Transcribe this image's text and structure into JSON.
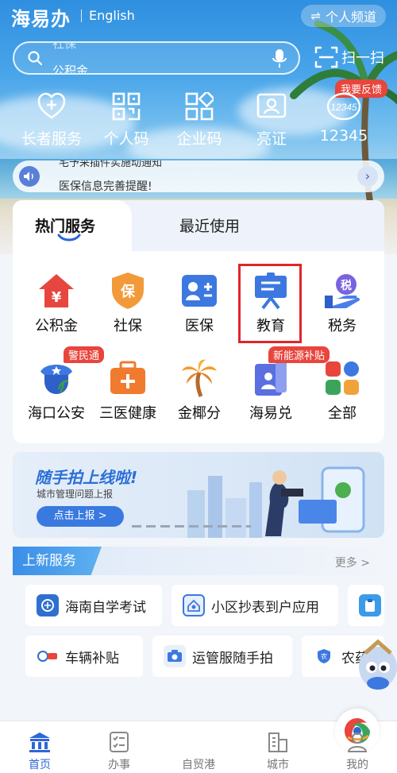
{
  "header": {
    "logo": "海易办",
    "language": "English",
    "channel_label": "个人频道"
  },
  "search": {
    "placeholder_prev": "社保",
    "placeholder_current": "公积金",
    "scan_label": "扫一扫"
  },
  "quick_actions": [
    {
      "label": "长者服务",
      "icon": "heart-plus-icon"
    },
    {
      "label": "个人码",
      "icon": "qr-code-icon"
    },
    {
      "label": "企业码",
      "icon": "enterprise-grid-icon"
    },
    {
      "label": "亮证",
      "icon": "id-card-icon"
    },
    {
      "label": "12345",
      "icon": "hotline-12345-icon"
    }
  ],
  "feedback_badge": "我要反馈",
  "notice": {
    "line_prev": "宅予采插件实施动通知",
    "line_current": "医保信息完善提醒!"
  },
  "services": {
    "tabs": [
      {
        "label": "热门服务",
        "active": true
      },
      {
        "label": "最近使用",
        "active": false
      }
    ],
    "items": [
      {
        "label": "公积金",
        "icon": "housing-fund-icon"
      },
      {
        "label": "社保",
        "icon": "social-security-icon"
      },
      {
        "label": "医保",
        "icon": "medical-insurance-icon"
      },
      {
        "label": "教育",
        "icon": "education-icon"
      },
      {
        "label": "税务",
        "icon": "tax-icon"
      },
      {
        "label": "海口公安",
        "icon": "police-icon",
        "tag": "警民通"
      },
      {
        "label": "三医健康",
        "icon": "health-kit-icon"
      },
      {
        "label": "金椰分",
        "icon": "coconut-tree-icon"
      },
      {
        "label": "海易兑",
        "icon": "exchange-icon",
        "tag": "新能源补贴"
      },
      {
        "label": "全部",
        "icon": "all-apps-icon"
      }
    ]
  },
  "banner": {
    "title": "随手拍上线啦!",
    "subtitle": "城市管理问题上报",
    "button": "点击上报 >"
  },
  "new_services": {
    "heading": "上新服务",
    "more": "更多 >",
    "items": [
      {
        "label": "海南自学考试",
        "icon": "self-study-exam-icon"
      },
      {
        "label": "小区抄表到户应用",
        "icon": "meter-reading-icon"
      },
      {
        "label": "",
        "icon": "clipboard-icon"
      },
      {
        "label": "车辆补贴",
        "icon": "vehicle-subsidy-icon"
      },
      {
        "label": "运管服随手拍",
        "icon": "camera-report-icon"
      },
      {
        "label": "农药供",
        "icon": "pesticide-icon"
      }
    ]
  },
  "bottom_nav": [
    {
      "label": "首页",
      "icon": "home-building-icon",
      "active": true
    },
    {
      "label": "办事",
      "icon": "checklist-icon",
      "active": false
    },
    {
      "label": "自贸港",
      "icon": "free-trade-port-logo-icon",
      "active": false
    },
    {
      "label": "城市",
      "icon": "city-icon",
      "active": false
    },
    {
      "label": "我的",
      "icon": "profile-icon",
      "active": false
    }
  ],
  "colors": {
    "brand_blue": "#2e67d6",
    "tag_red": "#e8453c",
    "highlight_red": "#e0262a"
  }
}
